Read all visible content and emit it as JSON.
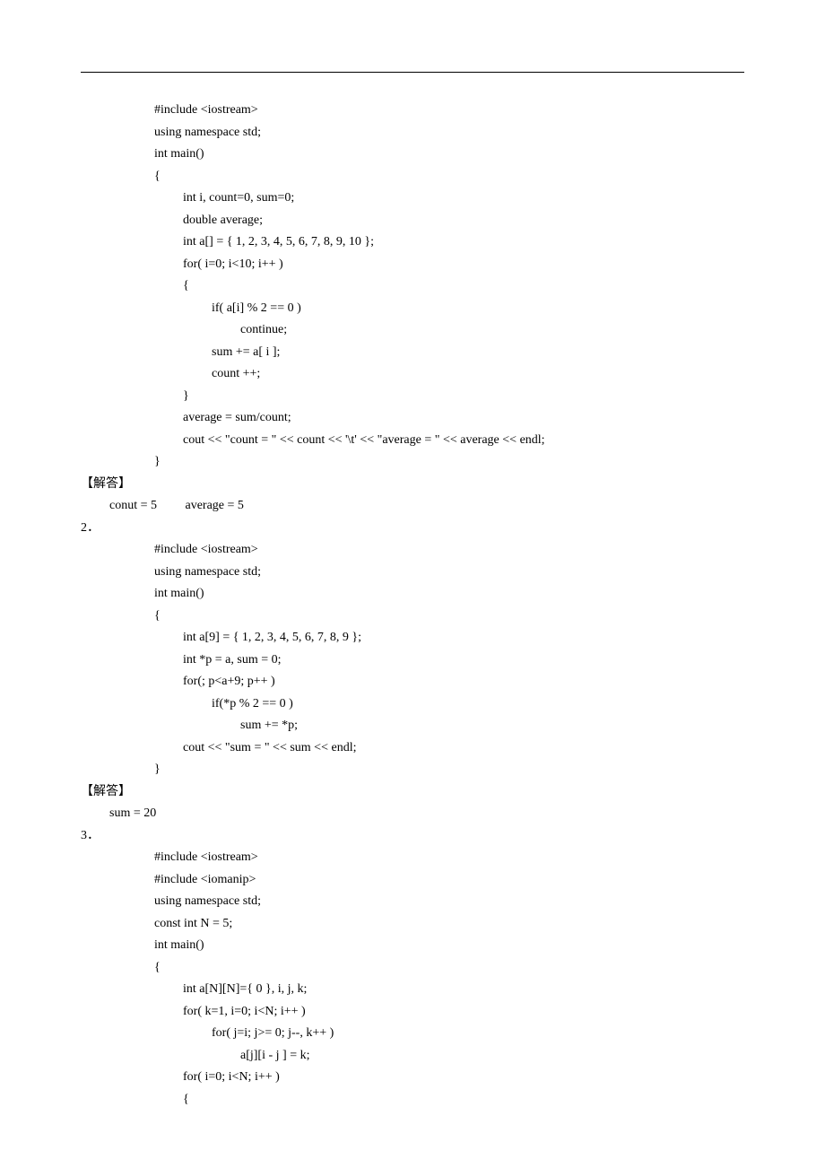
{
  "s1": {
    "l1": "#include <iostream>",
    "l2": "using namespace std;",
    "l3": "int main()",
    "l4": "{",
    "l5": "int i, count=0, sum=0;",
    "l6": "double average;",
    "l7": "int a[] = { 1, 2, 3, 4, 5, 6, 7, 8, 9, 10 };",
    "l8": "for( i=0; i<10; i++ )",
    "l9": "{",
    "l10": "if( a[i] % 2 == 0 )",
    "l11": "continue;",
    "l12": "sum += a[ i ];",
    "l13": "count ++;",
    "l14": "}",
    "l15": "average = sum/count;",
    "l16": "cout << \"count = \" << count << '\\t' << \"average = \" << average << endl;",
    "l17": "}",
    "ans_label": "【解答】",
    "ans": "conut = 5         average = 5"
  },
  "s2": {
    "num": "2．",
    "l1": "#include <iostream>",
    "l2": "using namespace std;",
    "l3": "int main()",
    "l4": "{",
    "l5": "int a[9] = { 1, 2, 3, 4, 5, 6, 7, 8, 9 };",
    "l6": "int *p = a, sum = 0;",
    "l7": "for(; p<a+9; p++ )",
    "l8": "if(*p % 2 == 0 )",
    "l9": "sum += *p;",
    "l10": "cout << \"sum = \" << sum << endl;",
    "l11": "}",
    "ans_label": "【解答】",
    "ans": "sum = 20"
  },
  "s3": {
    "num": "3．",
    "l1": "#include <iostream>",
    "l2": "#include <iomanip>",
    "l3": "using namespace std;",
    "l4": "const int N = 5;",
    "l5": "int main()",
    "l6": "{",
    "l7": "int a[N][N]={ 0 }, i, j, k;",
    "l8": "for( k=1, i=0; i<N; i++ )",
    "l9": "for( j=i; j>= 0; j--, k++ )",
    "l10": "a[j][i - j ] = k;",
    "l11": "for( i=0; i<N; i++ )",
    "l12": "{"
  }
}
